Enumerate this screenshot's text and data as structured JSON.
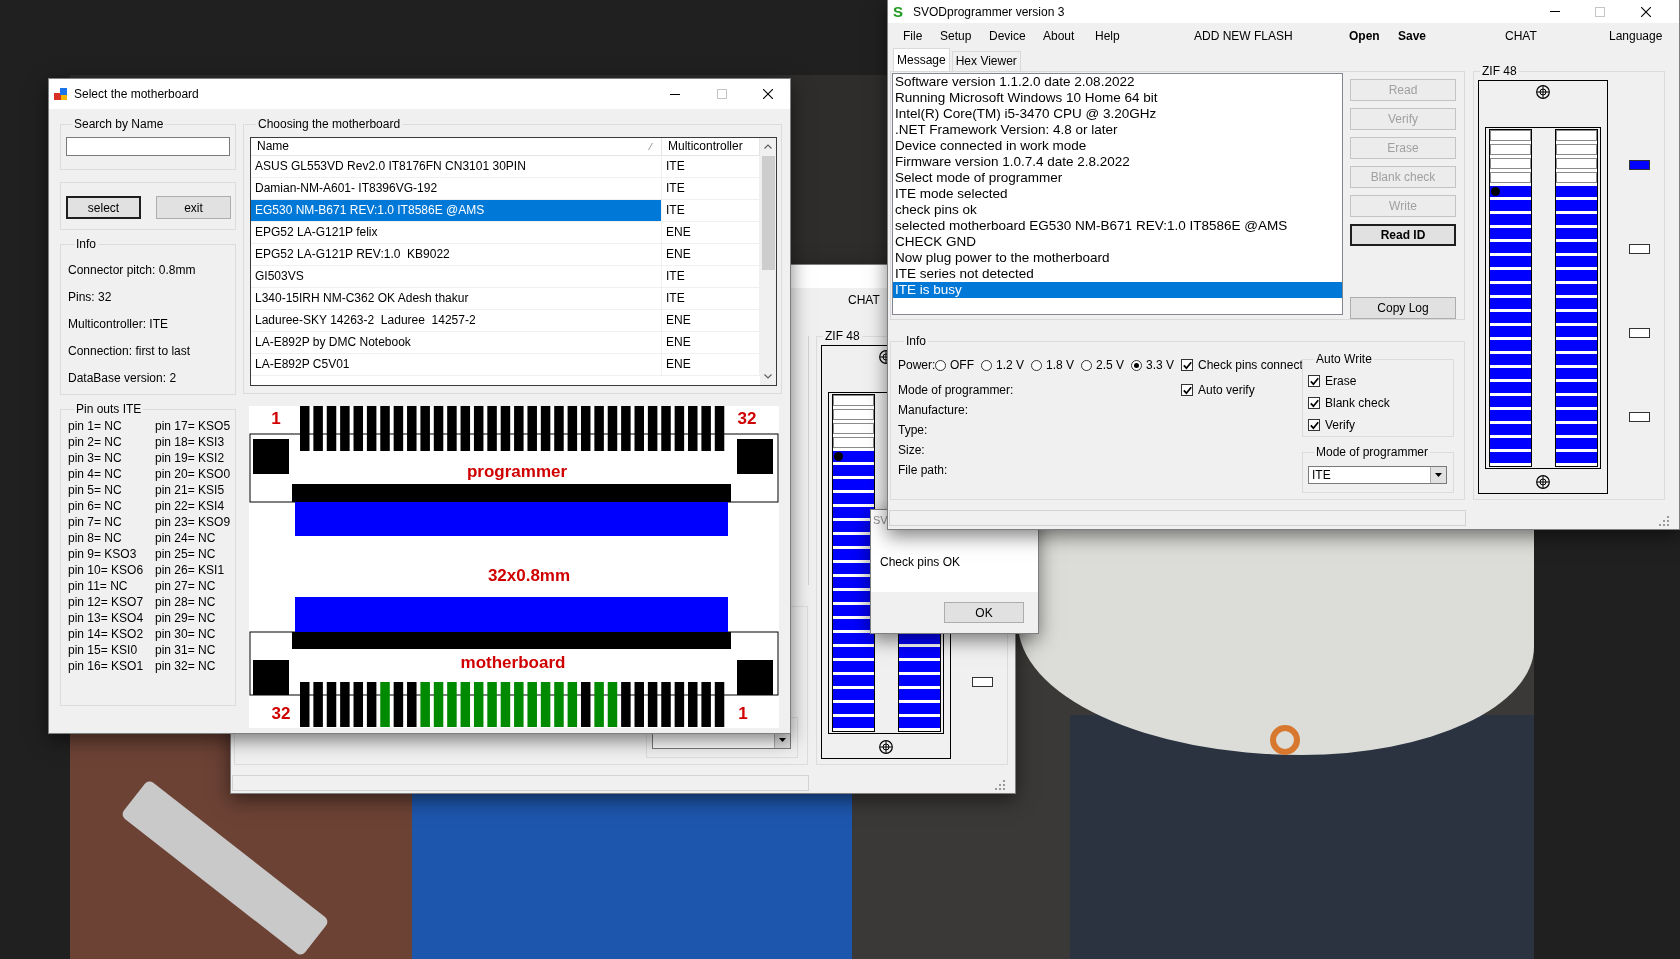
{
  "motherboard_dialog": {
    "title": "Select the motherboard",
    "maximize_enabled": false,
    "search": {
      "label": "Search by Name"
    },
    "buttons": [
      {
        "label": "select",
        "default": true
      },
      {
        "label": "exit",
        "default": false
      }
    ],
    "info": {
      "title": "Info",
      "lines": [
        "Connector pitch: 0.8mm",
        "Pins: 32",
        "Multicontroller: ITE",
        "Connection: first to last",
        "DataBase version: 2"
      ]
    },
    "list": {
      "title": "Choosing the motherboard",
      "columns": [
        "Name",
        "Multicontroller"
      ],
      "rows": [
        {
          "name": "ASUS GL553VD Rev2.0 IT8176FN CN3101 30PIN",
          "controller": "ITE",
          "selected": false
        },
        {
          "name": "Damian-NM-A601- IT8396VG-192",
          "controller": "ITE",
          "selected": false
        },
        {
          "name": "EG530 NM-B671 REV:1.0 IT8586E @AMS",
          "controller": "ITE",
          "selected": true
        },
        {
          "name": "EPG52 LA-G121P felix",
          "controller": "ENE",
          "selected": false
        },
        {
          "name": "EPG52 LA-G121P REV:1.0  KB9022",
          "controller": "ENE",
          "selected": false
        },
        {
          "name": "GI503VS",
          "controller": "ITE",
          "selected": false
        },
        {
          "name": "L340-15IRH NM-C362 OK Adesh thakur",
          "controller": "ITE",
          "selected": false
        },
        {
          "name": "Laduree-SKY 14263-2  Laduree  14257-2",
          "controller": "ENE",
          "selected": false
        },
        {
          "name": "LA-E892P by DMC Notebook",
          "controller": "ENE",
          "selected": false
        },
        {
          "name": "LA-E892P C5V01",
          "controller": "ENE",
          "selected": false
        }
      ]
    },
    "pinouts": {
      "title": "Pin outs ITE",
      "pins": [
        "pin 1= NC",
        "pin 2= NC",
        "pin 3= NC",
        "pin 4= NC",
        "pin 5= NC",
        "pin 6= NC",
        "pin 7= NC",
        "pin 8= NC",
        "pin 9= KSO3",
        "pin 10= KSO6",
        "pin 11= NC",
        "pin 12= KSO7",
        "pin 13= KSO4",
        "pin 14= KSO2",
        "pin 15= KSI0",
        "pin 16= KSO1",
        "pin 17= KSO5",
        "pin 18= KSI3",
        "pin 19= KSI2",
        "pin 20= KSO0",
        "pin 21= KSI5",
        "pin 22= KSI4",
        "pin 23= KSO9",
        "pin 24= NC",
        "pin 25= NC",
        "pin 26= KSI1",
        "pin 27= NC",
        "pin 28= NC",
        "pin 29= NC",
        "pin 30= NC",
        "pin 31= NC",
        "pin 32= NC"
      ]
    },
    "connector": {
      "programmer_label": "programmer",
      "motherboard_label": "motherboard",
      "cable_label": "32x0.8mm",
      "programmer_first": "1",
      "programmer_last": "32",
      "motherboard_first": "32",
      "motherboard_last": "1",
      "programmer_pins": [
        {
          "used": false
        },
        {
          "used": false
        },
        {
          "used": false
        },
        {
          "used": false
        },
        {
          "used": false
        },
        {
          "used": false
        },
        {
          "used": false
        },
        {
          "used": false
        },
        {
          "used": false
        },
        {
          "used": false
        },
        {
          "used": false
        },
        {
          "used": false
        },
        {
          "used": false
        },
        {
          "used": false
        },
        {
          "used": false
        },
        {
          "used": false
        },
        {
          "used": false
        },
        {
          "used": false
        },
        {
          "used": false
        },
        {
          "used": false
        },
        {
          "used": false
        },
        {
          "used": false
        },
        {
          "used": false
        },
        {
          "used": false
        },
        {
          "used": false
        },
        {
          "used": false
        },
        {
          "used": false
        },
        {
          "used": false
        },
        {
          "used": false
        },
        {
          "used": false
        },
        {
          "used": false
        },
        {
          "used": false
        }
      ],
      "motherboard_pins": [
        {
          "used": false
        },
        {
          "used": false
        },
        {
          "used": false
        },
        {
          "used": false
        },
        {
          "used": false
        },
        {
          "used": false
        },
        {
          "used": true
        },
        {
          "used": false
        },
        {
          "used": false
        },
        {
          "used": true
        },
        {
          "used": true
        },
        {
          "used": true
        },
        {
          "used": true
        },
        {
          "used": true
        },
        {
          "used": true
        },
        {
          "used": true
        },
        {
          "used": true
        },
        {
          "used": true
        },
        {
          "used": true
        },
        {
          "used": true
        },
        {
          "used": true
        },
        {
          "used": false
        },
        {
          "used": true
        },
        {
          "used": true
        },
        {
          "used": false
        },
        {
          "used": false
        },
        {
          "used": false
        },
        {
          "used": false
        },
        {
          "used": false
        },
        {
          "used": false
        },
        {
          "used": false
        },
        {
          "used": false
        }
      ]
    }
  },
  "background_window": {
    "menu_item": "CHAT",
    "zif": {
      "title": "ZIF 48",
      "left_rows": [
        {
          "active": false,
          "dot": false
        },
        {
          "active": false,
          "dot": false
        },
        {
          "active": false,
          "dot": false
        },
        {
          "active": false,
          "dot": false
        },
        {
          "active": true,
          "dot": true
        },
        {
          "active": true,
          "dot": false
        },
        {
          "active": true,
          "dot": false
        },
        {
          "active": true,
          "dot": false
        },
        {
          "active": true,
          "dot": false
        },
        {
          "active": true,
          "dot": false
        },
        {
          "active": true,
          "dot": false
        },
        {
          "active": true,
          "dot": false
        },
        {
          "active": true,
          "dot": false
        },
        {
          "active": true,
          "dot": false
        },
        {
          "active": true,
          "dot": false
        },
        {
          "active": true,
          "dot": false
        },
        {
          "active": true,
          "dot": false
        },
        {
          "active": true,
          "dot": false
        },
        {
          "active": true,
          "dot": false
        },
        {
          "active": true,
          "dot": false
        },
        {
          "active": true,
          "dot": false
        },
        {
          "active": true,
          "dot": false
        },
        {
          "active": true,
          "dot": false
        },
        {
          "active": true,
          "dot": false
        }
      ],
      "right_rows": [
        {
          "active": true,
          "dot": false
        },
        {
          "active": true,
          "dot": false
        },
        {
          "active": true,
          "dot": false
        },
        {
          "active": true,
          "dot": false
        },
        {
          "active": true,
          "dot": false
        },
        {
          "active": true,
          "dot": false
        },
        {
          "active": true,
          "dot": false
        }
      ],
      "indicators": [
        {
          "on": false
        }
      ]
    }
  },
  "message_box": {
    "title": "SV",
    "message": "Check pins OK",
    "button": "OK"
  },
  "programmer_window": {
    "logo": "S",
    "title": "SVODprogrammer version 3",
    "maximize_enabled": false,
    "menu": [
      {
        "label": "File",
        "bold": false
      },
      {
        "label": "Setup",
        "bold": false
      },
      {
        "label": "Device",
        "bold": false
      },
      {
        "label": "About",
        "bold": false
      },
      {
        "label": "Help",
        "bold": false
      },
      {
        "label": "ADD NEW FLASH",
        "bold": false
      },
      {
        "label": "Open",
        "bold": true
      },
      {
        "label": "Save",
        "bold": true
      },
      {
        "label": "CHAT",
        "bold": false
      },
      {
        "label": "Language",
        "bold": false
      }
    ],
    "tabs": [
      {
        "label": "Message",
        "selected": true
      },
      {
        "label": "Hex Viewer",
        "selected": false
      }
    ],
    "log": [
      {
        "text": "Software version 1.1.2.0 date 2.08.2022",
        "selected": false
      },
      {
        "text": "Running Microsoft Windows 10 Home 64 bit",
        "selected": false
      },
      {
        "text": "Intel(R) Core(TM) i5-3470 CPU @ 3.20GHz",
        "selected": false
      },
      {
        "text": ".NET Framework Version: 4.8 or later",
        "selected": false
      },
      {
        "text": "Device connected in work mode",
        "selected": false
      },
      {
        "text": "Firmware version 1.0.7.4 date 2.8.2022",
        "selected": false
      },
      {
        "text": "Select mode of programmer",
        "selected": false
      },
      {
        "text": "ITE mode selected",
        "selected": false
      },
      {
        "text": "check pins ok",
        "selected": false
      },
      {
        "text": "selected motherboard EG530 NM-B671 REV:1.0 IT8586E @AMS",
        "selected": false
      },
      {
        "text": "CHECK GND",
        "selected": false
      },
      {
        "text": "Now plug power to the motherboard",
        "selected": false
      },
      {
        "text": "ITE series not detected",
        "selected": false
      },
      {
        "text": "ITE is busy",
        "selected": true
      }
    ],
    "actions": [
      {
        "label": "Read",
        "disabled": true,
        "default": false
      },
      {
        "label": "Verify",
        "disabled": true,
        "default": false
      },
      {
        "label": "Erase",
        "disabled": true,
        "default": false
      },
      {
        "label": "Blank check",
        "disabled": true,
        "default": false
      },
      {
        "label": "Write",
        "disabled": true,
        "default": false
      },
      {
        "label": "Read ID",
        "disabled": false,
        "default": true
      }
    ],
    "copy_log": "Copy Log",
    "info": {
      "title": "Info",
      "power_label": "Power:",
      "power": [
        {
          "label": "OFF",
          "selected": false
        },
        {
          "label": "1.2 V",
          "selected": false
        },
        {
          "label": "1.8 V",
          "selected": false
        },
        {
          "label": "2.5 V",
          "selected": false
        },
        {
          "label": "3.3 V",
          "selected": true
        }
      ],
      "checks": [
        {
          "label": "Check pins connect",
          "checked": true
        },
        {
          "label": "Auto verify",
          "checked": true
        }
      ],
      "fields": [
        "Mode of programmer:",
        "Manufacture:",
        "Type:",
        "Size:",
        "File path:"
      ],
      "auto_write": {
        "title": "Auto Write",
        "options": [
          {
            "label": "Erase",
            "checked": true
          },
          {
            "label": "Blank check",
            "checked": true
          },
          {
            "label": "Verify",
            "checked": true
          }
        ]
      },
      "mode": {
        "title": "Mode of programmer",
        "value": "ITE"
      }
    },
    "zif": {
      "title": "ZIF 48",
      "left_rows": [
        {
          "active": false,
          "dot": false
        },
        {
          "active": false,
          "dot": false
        },
        {
          "active": false,
          "dot": false
        },
        {
          "active": false,
          "dot": false
        },
        {
          "active": true,
          "dot": true
        },
        {
          "active": true,
          "dot": false
        },
        {
          "active": true,
          "dot": false
        },
        {
          "active": true,
          "dot": false
        },
        {
          "active": true,
          "dot": false
        },
        {
          "active": true,
          "dot": false
        },
        {
          "active": true,
          "dot": false
        },
        {
          "active": true,
          "dot": false
        },
        {
          "active": true,
          "dot": false
        },
        {
          "active": true,
          "dot": false
        },
        {
          "active": true,
          "dot": false
        },
        {
          "active": true,
          "dot": false
        },
        {
          "active": true,
          "dot": false
        },
        {
          "active": true,
          "dot": false
        },
        {
          "active": true,
          "dot": false
        },
        {
          "active": true,
          "dot": false
        },
        {
          "active": true,
          "dot": false
        },
        {
          "active": true,
          "dot": false
        },
        {
          "active": true,
          "dot": false
        },
        {
          "active": true,
          "dot": false
        }
      ],
      "right_rows": [
        {
          "active": false,
          "dot": false
        },
        {
          "active": false,
          "dot": false
        },
        {
          "active": false,
          "dot": false
        },
        {
          "active": false,
          "dot": false
        },
        {
          "active": true,
          "dot": false
        },
        {
          "active": true,
          "dot": false
        },
        {
          "active": true,
          "dot": false
        },
        {
          "active": true,
          "dot": false
        },
        {
          "active": true,
          "dot": false
        },
        {
          "active": true,
          "dot": false
        },
        {
          "active": true,
          "dot": false
        },
        {
          "active": true,
          "dot": false
        },
        {
          "active": true,
          "dot": false
        },
        {
          "active": true,
          "dot": false
        },
        {
          "active": true,
          "dot": false
        },
        {
          "active": true,
          "dot": false
        },
        {
          "active": true,
          "dot": false
        },
        {
          "active": true,
          "dot": false
        },
        {
          "active": true,
          "dot": false
        },
        {
          "active": true,
          "dot": false
        },
        {
          "active": true,
          "dot": false
        },
        {
          "active": true,
          "dot": false
        },
        {
          "active": true,
          "dot": false
        },
        {
          "active": true,
          "dot": false
        }
      ],
      "indicators": [
        {
          "on": true
        },
        {
          "on": false
        },
        {
          "on": false
        },
        {
          "on": false
        }
      ]
    }
  }
}
